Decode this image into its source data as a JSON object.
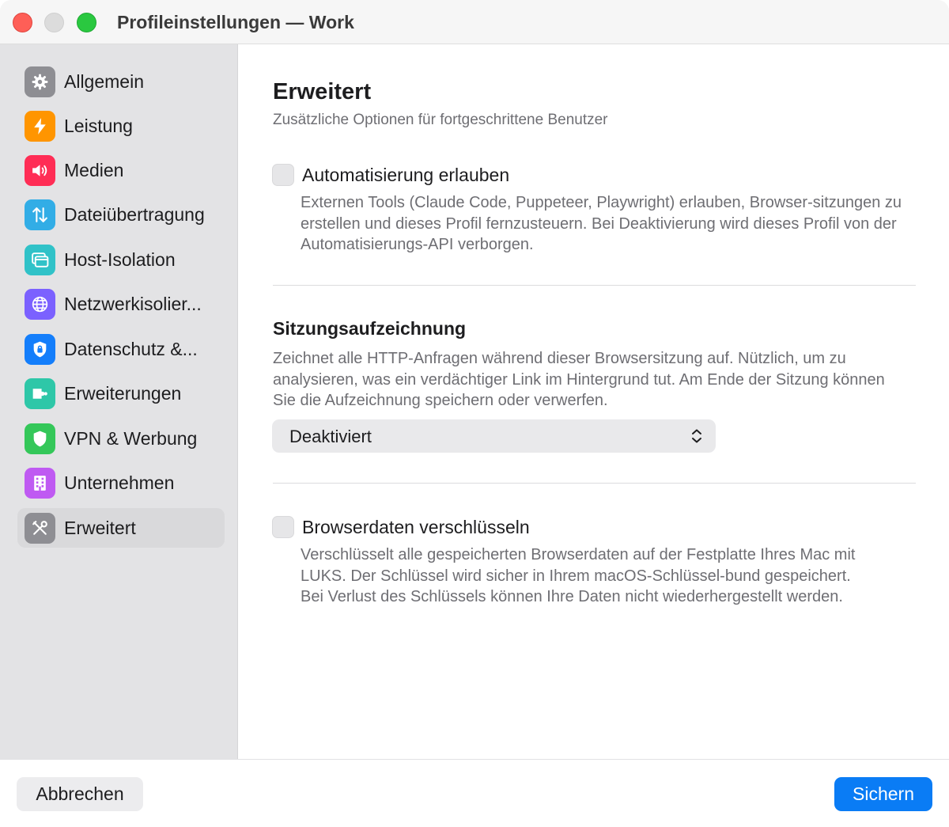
{
  "window": {
    "title": "Profileinstellungen — Work"
  },
  "sidebar": {
    "items": [
      {
        "label": "Allgemein",
        "icon": "gear-icon",
        "color": "#8e8e93",
        "selected": false
      },
      {
        "label": "Leistung",
        "icon": "bolt-icon",
        "color": "#ff9500",
        "selected": false
      },
      {
        "label": "Medien",
        "icon": "speaker-icon",
        "color": "#ff2d55",
        "selected": false
      },
      {
        "label": "Dateiübertragung",
        "icon": "transfer-arrows-icon",
        "color": "#32ade6",
        "selected": false
      },
      {
        "label": "Host-Isolation",
        "icon": "window-stack-icon",
        "color": "#30c2c8",
        "selected": false
      },
      {
        "label": "Netzwerkisolier...",
        "icon": "globe-icon",
        "color": "#7b61ff",
        "selected": false
      },
      {
        "label": "Datenschutz &...",
        "icon": "privacy-lock-icon",
        "color": "#147efb",
        "selected": false
      },
      {
        "label": "Erweiterungen",
        "icon": "extension-icon",
        "color": "#2ec7a8",
        "selected": false
      },
      {
        "label": "VPN & Werbung",
        "icon": "shield-icon",
        "color": "#34c759",
        "selected": false
      },
      {
        "label": "Unternehmen",
        "icon": "building-icon",
        "color": "#bf5af2",
        "selected": false
      },
      {
        "label": "Erweitert",
        "icon": "tools-icon",
        "color": "#8e8e93",
        "selected": true
      }
    ]
  },
  "main": {
    "title": "Erweitert",
    "subtitle": "Zusätzliche Optionen für fortgeschrittene Benutzer",
    "automation": {
      "label": "Automatisierung erlauben",
      "checked": false,
      "description": "Externen Tools (Claude Code, Puppeteer, Playwright) erlauben, Browser-sitzungen zu erstellen und dieses Profil fernzusteuern. Bei Deaktivierung wird dieses Profil von der Automatisierungs-API verborgen."
    },
    "recording": {
      "title": "Sitzungsaufzeichnung",
      "description": "Zeichnet alle HTTP-Anfragen während dieser Browsersitzung auf. Nützlich, um zu analysieren, was ein verdächtiger Link im Hintergrund tut. Am Ende der Sitzung können Sie die Aufzeichnung speichern oder verwerfen.",
      "selected": "Deaktiviert"
    },
    "encryption": {
      "label": "Browserdaten verschlüsseln",
      "checked": false,
      "description": "Verschlüsselt alle gespeicherten Browserdaten auf der Festplatte Ihres Mac mit LUKS. Der Schlüssel wird sicher in Ihrem macOS-Schlüssel-bund gespeichert. Bei Verlust des Schlüssels können Ihre Daten nicht wiederhergestellt werden."
    }
  },
  "footer": {
    "cancel_label": "Abbrechen",
    "save_label": "Sichern",
    "accent": "#0a7cf5"
  }
}
